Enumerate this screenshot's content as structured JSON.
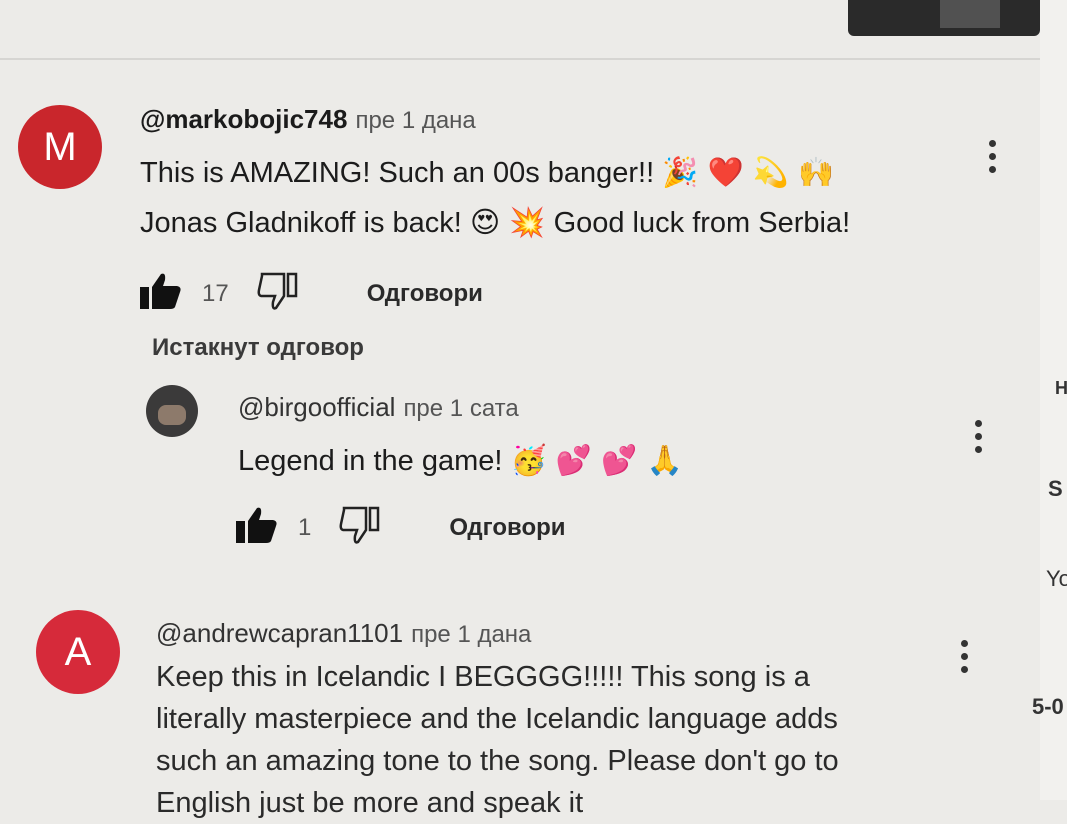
{
  "comments": [
    {
      "avatar_letter": "M",
      "handle": "@markobojic748",
      "time": "пре 1 дана",
      "line1": "This is AMAZING! Such an 00s banger!!",
      "line1_emoji": "🎉 ❤️ 💫 🙌",
      "line2a": "Jonas Gladnikoff is back!",
      "line2_emoji": "😍 💥",
      "line2b": "Good luck from Serbia!",
      "likes": "17",
      "reply_label": "Одговори",
      "highlighted_reply_label": "Истакнут одговор"
    },
    {
      "handle": "@andrewcapran1101",
      "avatar_letter": "A",
      "time": "пре 1 дана",
      "lines": [
        "Keep this in Icelandic I BEGGGG!!!!! This song is a",
        "literally masterpiece and the Icelandic language adds",
        "such an amazing tone to the song. Please don't go to",
        "English just be more and speak it"
      ]
    }
  ],
  "reply": {
    "handle": "@birgoofficial",
    "time": "пре 1 сата",
    "text": "Legend in the game!",
    "emoji": "🥳 💕 💕 🙏",
    "likes": "1",
    "reply_label": "Одговори"
  },
  "sidebar_fragments": [
    "H",
    "S",
    "Yo",
    "5-0"
  ],
  "colors": {
    "avatar_m": "#c9262c",
    "avatar_a": "#d62a3a",
    "background": "#ecebe8"
  },
  "icons": [
    "thumbs-up-icon",
    "thumbs-down-icon",
    "more-vert-icon"
  ]
}
